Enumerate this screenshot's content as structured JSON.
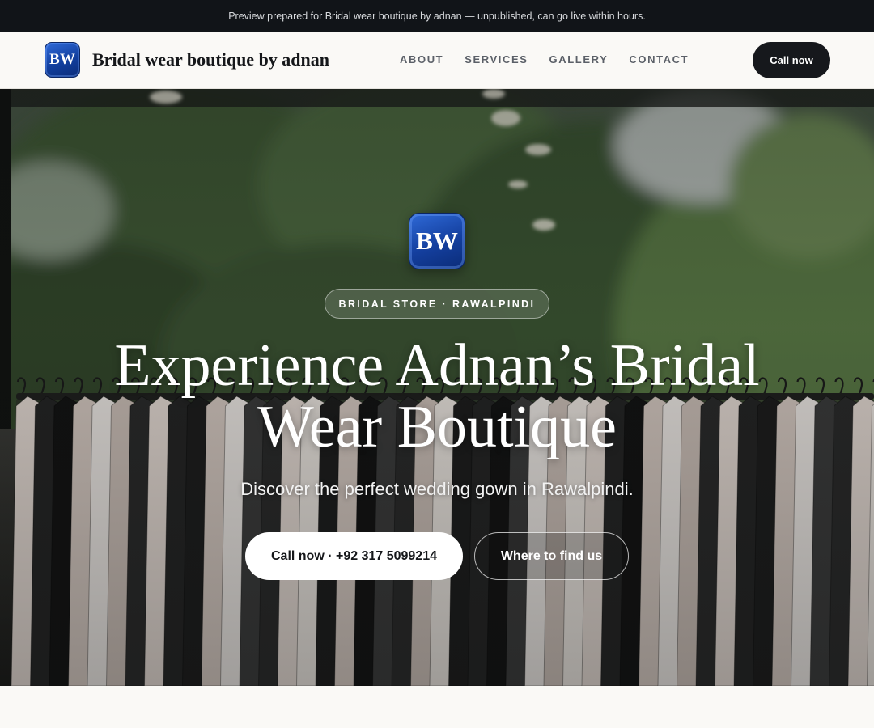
{
  "banner": {
    "text": "Preview prepared for Bridal wear boutique by adnan — unpublished, can go live within hours."
  },
  "header": {
    "logo_text": "BW",
    "brand_name": "Bridal wear boutique by adnan",
    "nav": [
      "ABOUT",
      "SERVICES",
      "GALLERY",
      "CONTACT"
    ],
    "call_button": "Call now"
  },
  "hero": {
    "logo_text": "BW",
    "eyebrow": "BRIDAL STORE · RAWALPINDI",
    "title_line1": "Experience Adnan’s Bridal",
    "title_line2": "Wear Boutique",
    "subtitle": "Discover the perfect wedding gown in Rawalpindi.",
    "call_button": "Call now · +92 317 5099214",
    "find_button": "Where to find us",
    "background": "clothing-rack-photo"
  },
  "colors": {
    "topbar": "#111418",
    "page_bg": "#faf9f6",
    "logo_blue": "#143f9e",
    "dark_button": "#16181c"
  }
}
